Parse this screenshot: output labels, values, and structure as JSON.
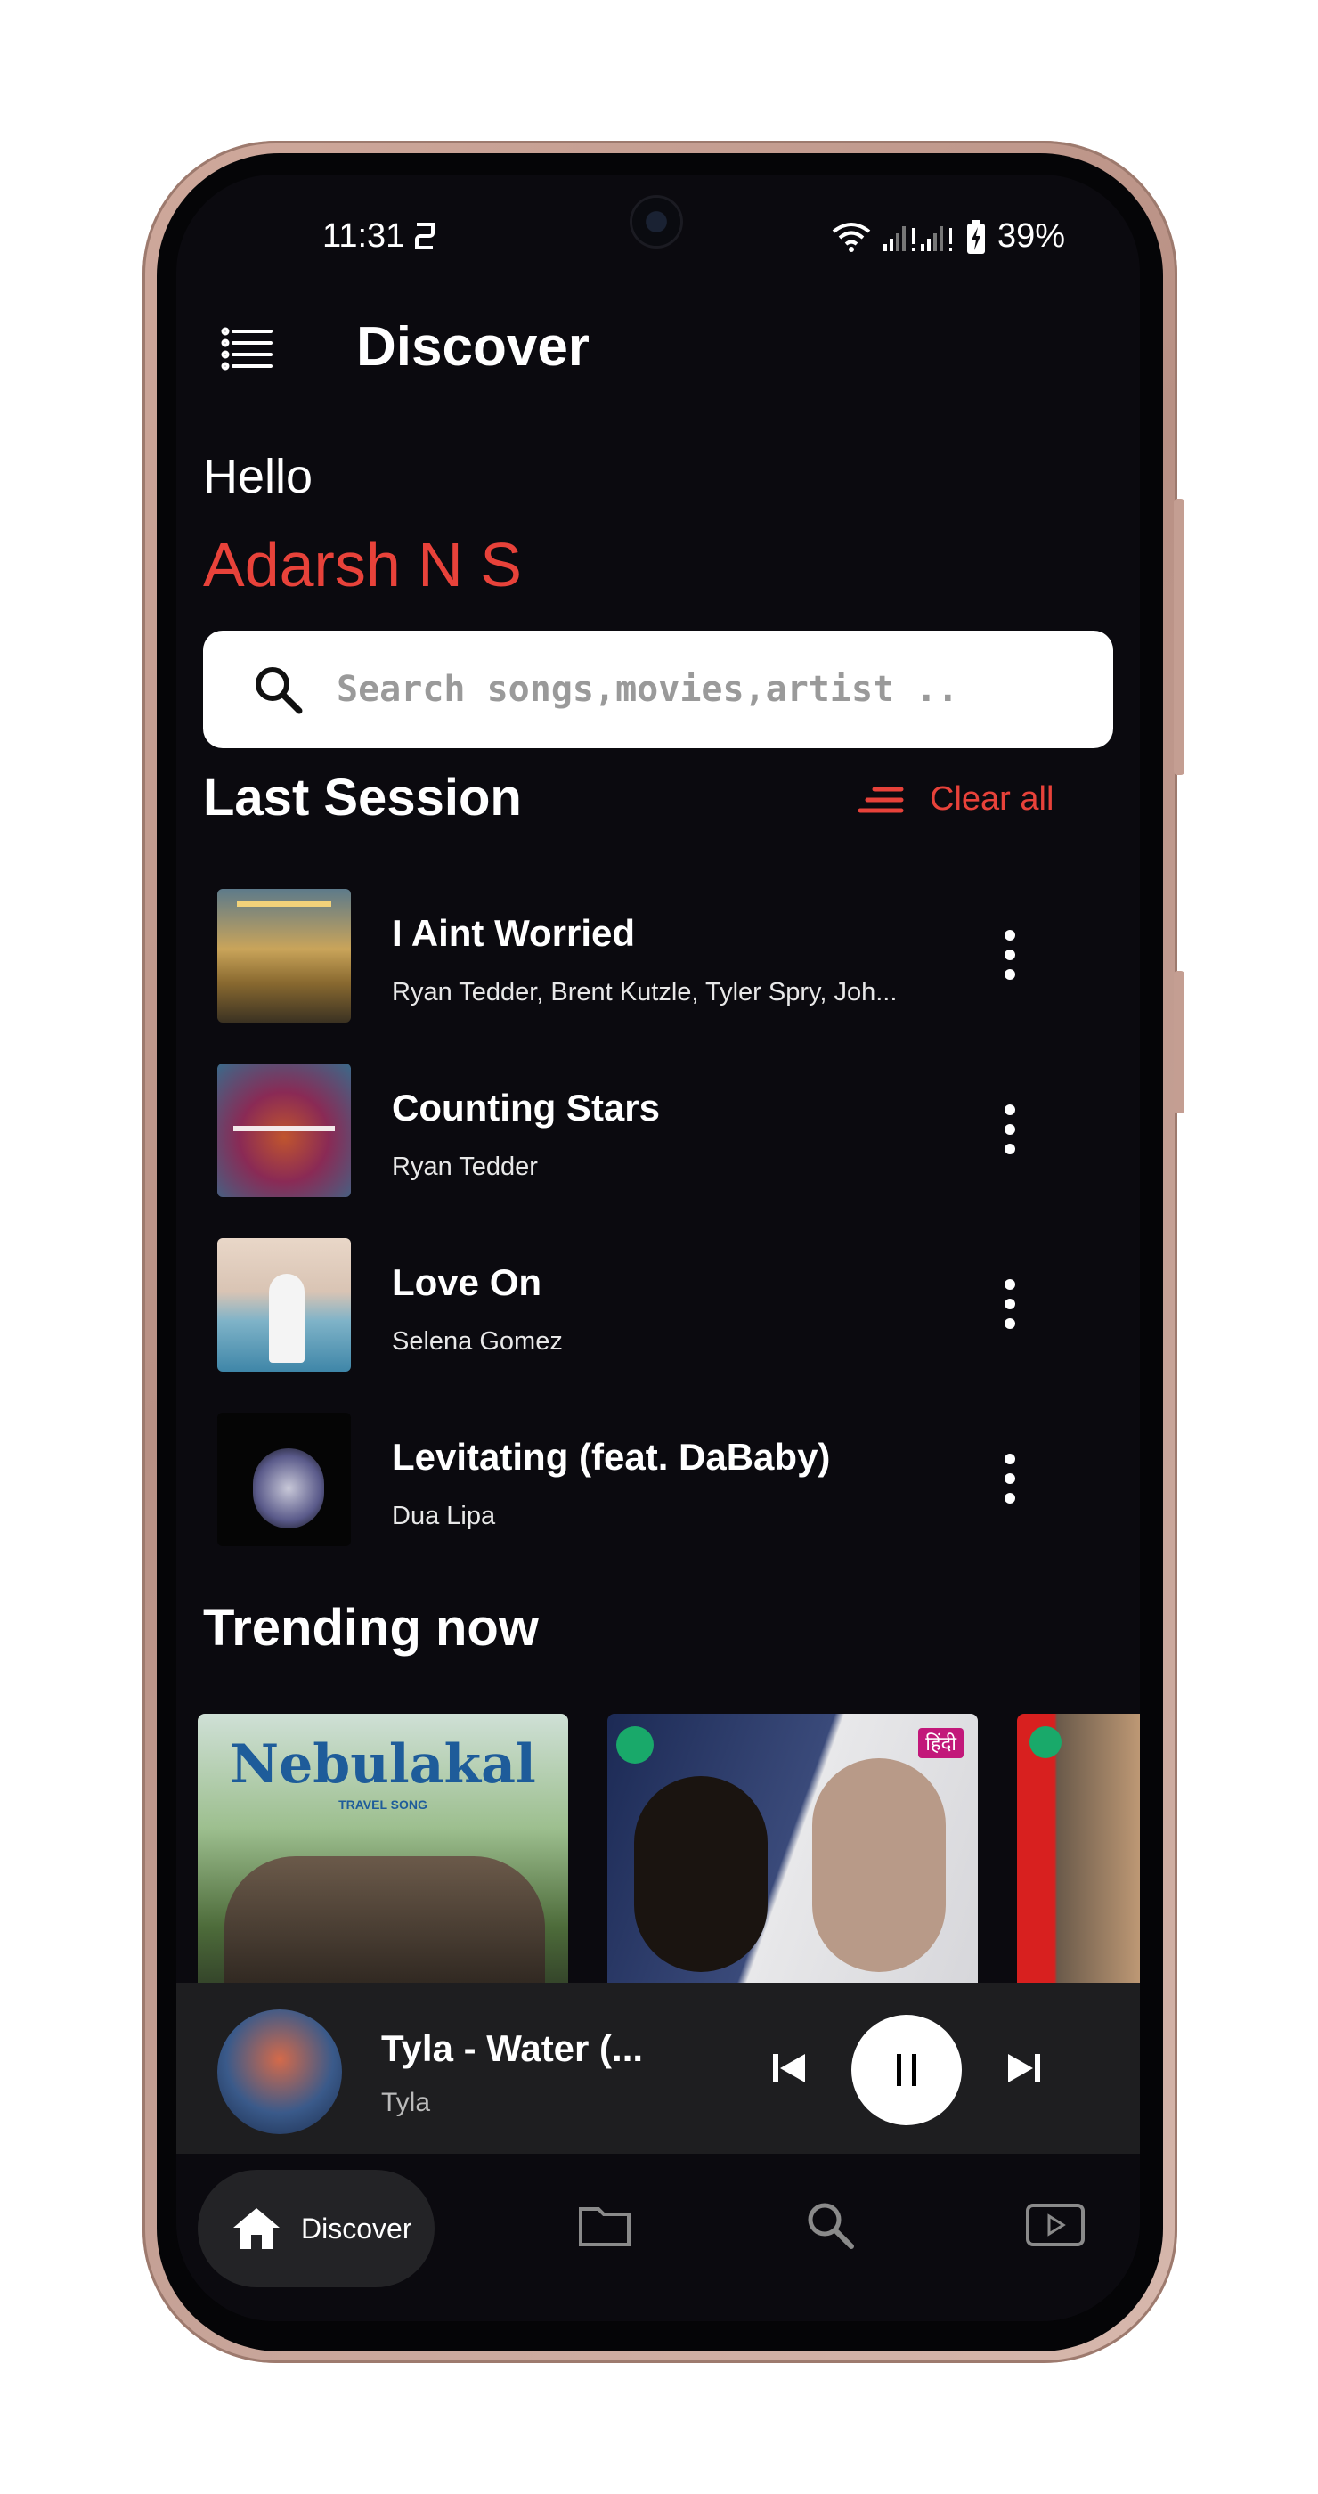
{
  "status_bar": {
    "time": "11:31",
    "battery": "39%"
  },
  "header": {
    "title": "Discover",
    "menu_icon": "list-menu-icon"
  },
  "greeting": {
    "hello": "Hello",
    "name": "Adarsh N S"
  },
  "search": {
    "placeholder": "Search songs,movies,artist .."
  },
  "last_session": {
    "title": "Last Session",
    "clear_label": "Clear all",
    "songs": [
      {
        "title": "I Aint Worried",
        "artists": "Ryan Tedder, Brent Kutzle, Tyler Spry, Joh..."
      },
      {
        "title": "Counting Stars",
        "artists": "Ryan Tedder"
      },
      {
        "title": "Love On",
        "artists": "Selena Gomez"
      },
      {
        "title": "Levitating (feat. DaBaby)",
        "artists": "Dua Lipa"
      }
    ]
  },
  "trending": {
    "title": "Trending now",
    "cards": [
      {
        "heading": "Nebulakal",
        "subheading": "TRAVEL SONG"
      },
      {
        "tag": "हिंदी"
      },
      {}
    ]
  },
  "now_playing": {
    "title": "Tyla - Water (...",
    "artist": "Tyla"
  },
  "nav": {
    "active_label": "Discover"
  },
  "colors": {
    "accent": "#e8423a",
    "background": "#0b0a0f",
    "player": "#1e1e20"
  }
}
